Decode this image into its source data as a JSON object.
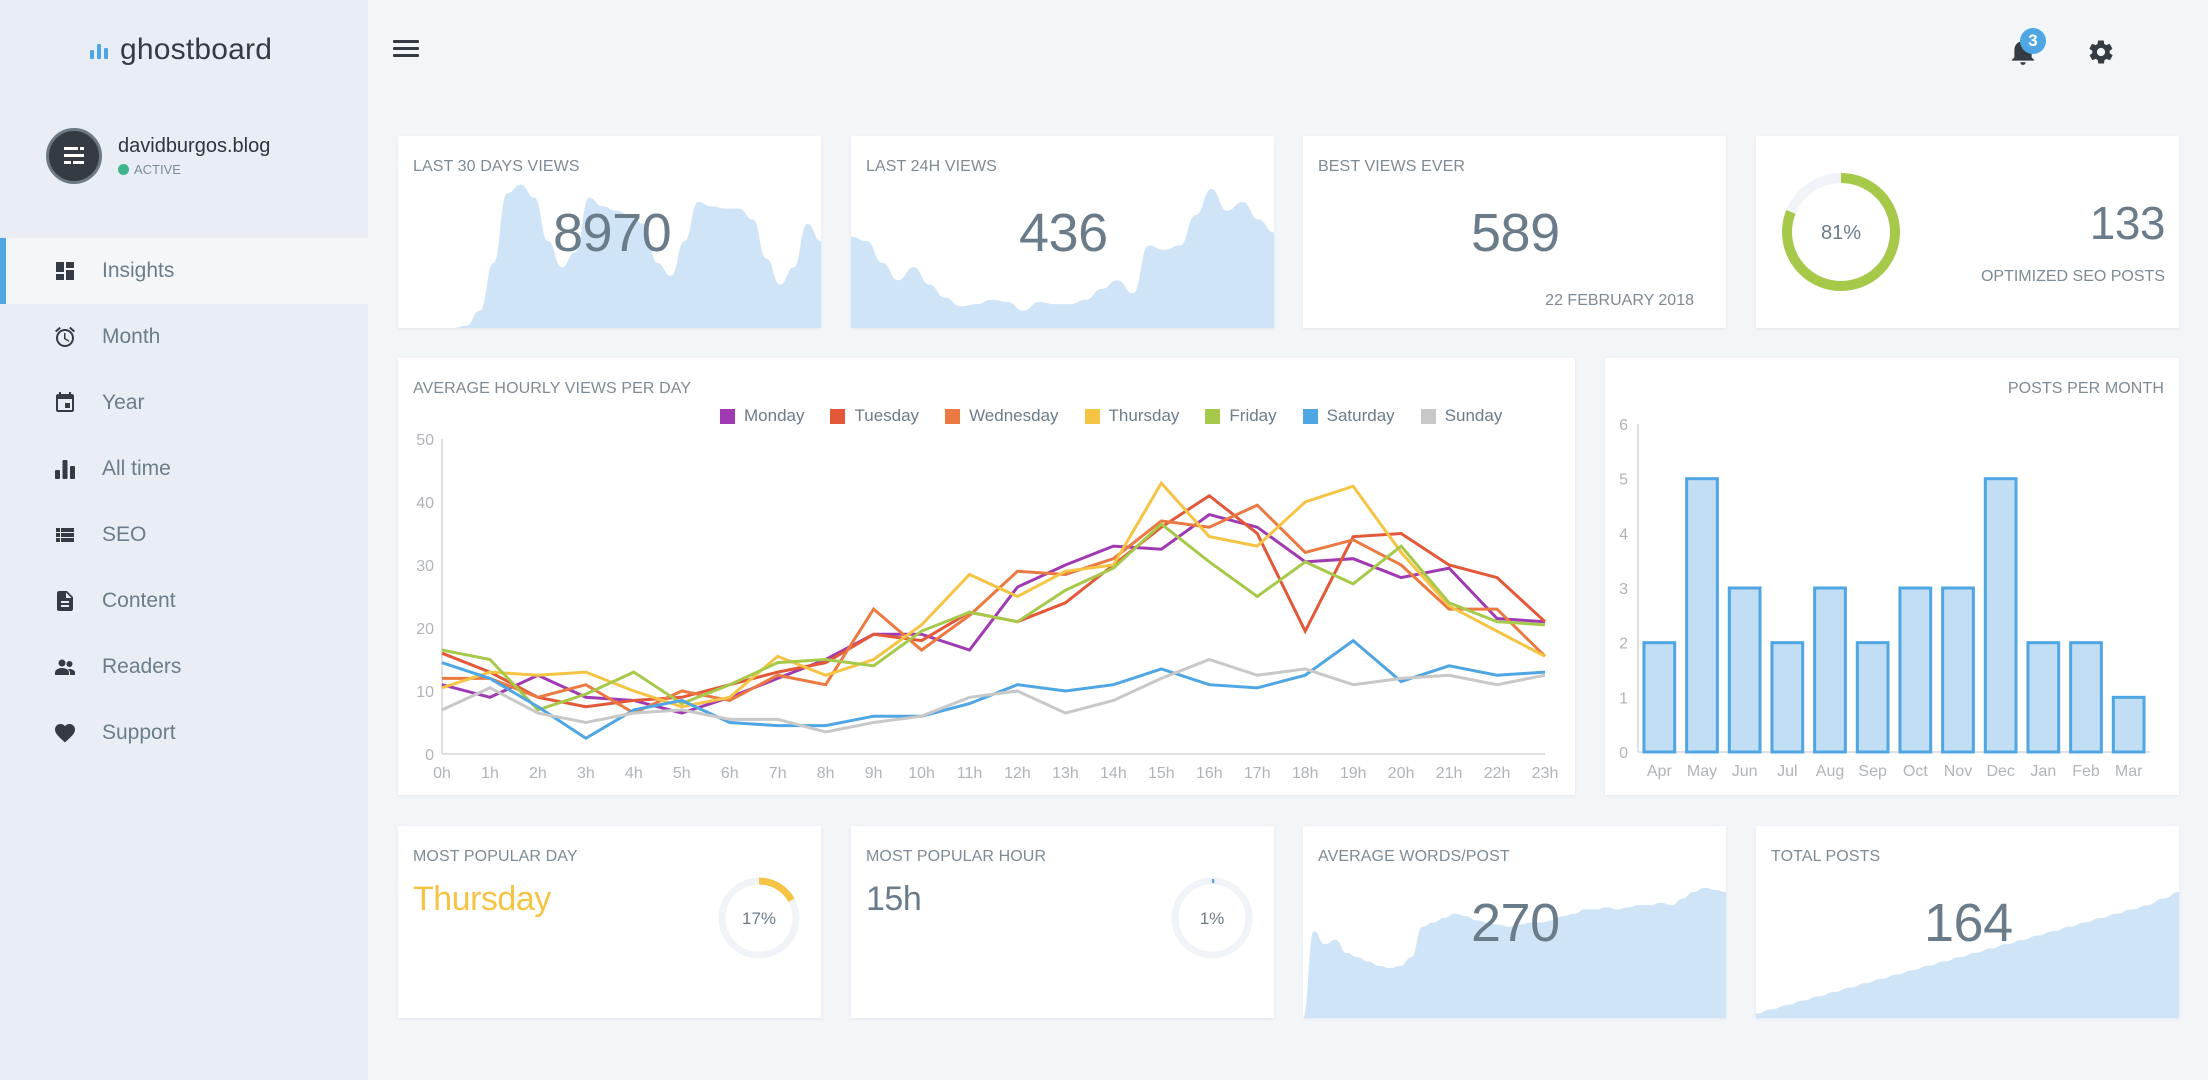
{
  "app": {
    "brand_name": "ghostboard",
    "brand_color": "#4fa6e3"
  },
  "profile": {
    "site": "davidburgos.blog",
    "status": "ACTIVE",
    "status_color": "#3fb58c"
  },
  "sidebar": {
    "items": [
      {
        "label": "Insights",
        "icon": "dashboard-icon",
        "active": true
      },
      {
        "label": "Month",
        "icon": "alarm-clock-icon",
        "active": false
      },
      {
        "label": "Year",
        "icon": "calendar-icon",
        "active": false
      },
      {
        "label": "All time",
        "icon": "bar-chart-icon",
        "active": false
      },
      {
        "label": "SEO",
        "icon": "list-icon",
        "active": false
      },
      {
        "label": "Content",
        "icon": "document-icon",
        "active": false
      },
      {
        "label": "Readers",
        "icon": "people-icon",
        "active": false
      },
      {
        "label": "Support",
        "icon": "heart-icon",
        "active": false
      }
    ]
  },
  "topbar": {
    "notifications_count": "3"
  },
  "cards": {
    "last30": {
      "title": "LAST 30 DAYS VIEWS",
      "value": "8970"
    },
    "last24": {
      "title": "LAST 24H VIEWS",
      "value": "436"
    },
    "best": {
      "title": "BEST VIEWS EVER",
      "value": "589",
      "date": "22 FEBRUARY 2018"
    },
    "seo": {
      "percent_label": "81%",
      "percent": 81,
      "value": "133",
      "label": "OPTIMIZED SEO POSTS",
      "color": "#a7c94a"
    },
    "popular_day": {
      "title": "MOST POPULAR DAY",
      "value": "Thursday",
      "percent_label": "17%",
      "percent": 17,
      "color": "#f6c445"
    },
    "popular_hour": {
      "title": "MOST POPULAR HOUR",
      "value": "15h",
      "percent_label": "1%",
      "percent": 1,
      "color": "#4fa6e3"
    },
    "avg_words": {
      "title": "AVERAGE WORDS/POST",
      "value": "270"
    },
    "total_posts": {
      "title": "TOTAL POSTS",
      "value": "164"
    }
  },
  "chart_data": [
    {
      "type": "line",
      "title": "AVERAGE HOURLY VIEWS PER DAY",
      "xlabel": "",
      "ylabel": "",
      "ylim": [
        0,
        50
      ],
      "yticks": [
        0,
        10,
        20,
        30,
        40,
        50
      ],
      "legend": "top",
      "x": [
        "0h",
        "1h",
        "2h",
        "3h",
        "4h",
        "5h",
        "6h",
        "7h",
        "8h",
        "9h",
        "10h",
        "11h",
        "12h",
        "13h",
        "14h",
        "15h",
        "16h",
        "17h",
        "18h",
        "19h",
        "20h",
        "21h",
        "22h",
        "23h"
      ],
      "series": [
        {
          "name": "Monday",
          "color": "#a03ab2",
          "values": [
            11,
            9,
            12.5,
            9,
            8.5,
            6.5,
            9,
            12,
            15,
            19,
            19,
            16.5,
            26.5,
            30,
            33,
            32.5,
            38,
            36,
            30.5,
            31,
            28,
            29.5,
            21.5,
            21
          ]
        },
        {
          "name": "Tuesday",
          "color": "#e4583a",
          "values": [
            16,
            13,
            9,
            7.5,
            8.5,
            9,
            11,
            13,
            14.5,
            19,
            18,
            22.5,
            21,
            24,
            30,
            36,
            41,
            35,
            19.5,
            34.5,
            35,
            30,
            28,
            21
          ]
        },
        {
          "name": "Wednesday",
          "color": "#ea7a41",
          "values": [
            12,
            12,
            9,
            11,
            6.5,
            10,
            8.5,
            12.5,
            11,
            23,
            16.5,
            22,
            29,
            28.5,
            31,
            37,
            36,
            39.5,
            32,
            34,
            30,
            23,
            23,
            15.5
          ]
        },
        {
          "name": "Thursday",
          "color": "#f6c445",
          "values": [
            10.5,
            13,
            12.5,
            13,
            10,
            7.5,
            9,
            15.5,
            12.5,
            15,
            20.5,
            28.5,
            25,
            29,
            30,
            43,
            34.5,
            33,
            40,
            42.5,
            32,
            23.5,
            19.5,
            15.5
          ]
        },
        {
          "name": "Friday",
          "color": "#a7c94a",
          "values": [
            16.5,
            15,
            7,
            9.5,
            13,
            8,
            11,
            14.5,
            15,
            14,
            19.5,
            22.5,
            21,
            26,
            29.5,
            36.5,
            30.5,
            25,
            30.5,
            27,
            33,
            24,
            21,
            20.5
          ]
        },
        {
          "name": "Saturday",
          "color": "#4fa6e3",
          "values": [
            14.5,
            12,
            7.5,
            2.5,
            7,
            8.5,
            5,
            4.5,
            4.5,
            6,
            6,
            8,
            11,
            10,
            11,
            13.5,
            11,
            10.5,
            12.5,
            18,
            11.5,
            14,
            12.5,
            13
          ]
        },
        {
          "name": "Sunday",
          "color": "#c8c8c8",
          "values": [
            7,
            10.5,
            6.5,
            5,
            6.5,
            7,
            5.5,
            5.5,
            3.5,
            5,
            6,
            9,
            10,
            6.5,
            8.5,
            12,
            15,
            12.5,
            13.5,
            11,
            12,
            12.5,
            11,
            12.5
          ]
        }
      ]
    },
    {
      "type": "bar",
      "title": "POSTS PER MONTH",
      "xlabel": "",
      "ylabel": "",
      "ylim": [
        0,
        6
      ],
      "yticks": [
        0,
        1,
        2,
        3,
        4,
        5,
        6
      ],
      "categories": [
        "Apr",
        "May",
        "Jun",
        "Jul",
        "Aug",
        "Sep",
        "Oct",
        "Nov",
        "Dec",
        "Jan",
        "Feb",
        "Mar"
      ],
      "values": [
        2,
        5,
        3,
        2,
        3,
        2,
        3,
        3,
        5,
        2,
        2,
        1
      ],
      "color": "#4fa6e3"
    }
  ],
  "sparklines": {
    "last30": [
      0,
      0,
      0,
      0,
      0,
      1,
      8,
      30,
      62,
      66,
      60,
      40,
      28,
      35,
      60,
      56,
      54,
      52,
      48,
      30,
      24,
      40,
      58,
      56,
      55,
      55,
      50,
      32,
      20,
      28,
      48,
      40
    ],
    "last24": [
      42,
      40,
      30,
      22,
      28,
      20,
      14,
      10,
      11,
      13,
      12,
      8,
      12,
      11,
      11,
      13,
      18,
      22,
      16,
      38,
      36,
      38,
      52,
      64,
      54,
      58,
      50,
      44
    ],
    "avg_words": [
      0,
      40,
      34,
      36,
      30,
      28,
      26,
      24,
      23,
      24,
      28,
      42,
      44,
      46,
      48,
      47,
      45,
      44,
      43,
      42,
      43,
      44,
      44,
      45,
      47,
      48,
      50,
      50,
      51,
      50,
      51,
      52,
      52,
      53,
      52,
      55,
      58,
      60,
      59,
      58
    ],
    "total_posts": [
      2,
      4,
      6,
      8,
      10,
      12,
      14,
      16,
      18,
      20,
      22,
      24,
      26,
      28,
      30,
      32,
      34,
      36,
      38,
      40,
      42,
      44,
      46,
      48,
      50,
      52,
      55,
      58
    ]
  }
}
